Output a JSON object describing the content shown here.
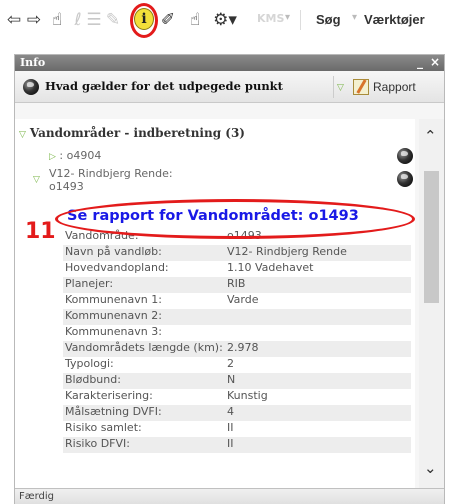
{
  "toolbar": {
    "back_icon": "arrow-left-icon",
    "forward_icon": "arrow-right-icon",
    "kms_label": "KMS",
    "menu_items": [
      "Søg",
      "Værktøjer"
    ]
  },
  "panel": {
    "title": "Info",
    "minimize_label": "_",
    "close_label": "×",
    "subtitle": "Hvad gælder for det udpegede punkt",
    "report_button_label": "Rapport"
  },
  "tree": {
    "section_label": "Vandområder - indberetning (3)",
    "node1_label": ": o4904",
    "node2_label_line1": "V12- Rindbjerg Rende:",
    "node2_label_line2": "o1493"
  },
  "report_link": "Se rapport for Vandområdet: o1493",
  "annotation_number": "11",
  "properties": [
    {
      "key": "Vandområde:",
      "value": "o1493"
    },
    {
      "key": "Navn på vandløb:",
      "value": "V12- Rindbjerg Rende"
    },
    {
      "key": "Hovedvandopland:",
      "value": "1.10 Vadehavet"
    },
    {
      "key": "Planejer:",
      "value": "RIB"
    },
    {
      "key": "Kommunenavn 1:",
      "value": "Varde"
    },
    {
      "key": "Kommunenavn 2:",
      "value": ""
    },
    {
      "key": "Kommunenavn 3:",
      "value": ""
    },
    {
      "key": "Vandområdets længde (km):",
      "value": "2.978"
    },
    {
      "key": "Typologi:",
      "value": "2"
    },
    {
      "key": "Blødbund:",
      "value": "N"
    },
    {
      "key": "Karakterisering:",
      "value": "Kunstig"
    },
    {
      "key": "Målsætning DVFI:",
      "value": "4"
    },
    {
      "key": "Risiko samlet:",
      "value": "II"
    },
    {
      "key": "Risiko DFVI:",
      "value": "II"
    }
  ],
  "status_text": "Færdig",
  "colors": {
    "highlight_red": "#e31b1b",
    "link_blue": "#1919e6",
    "tree_green": "#7ab648"
  }
}
